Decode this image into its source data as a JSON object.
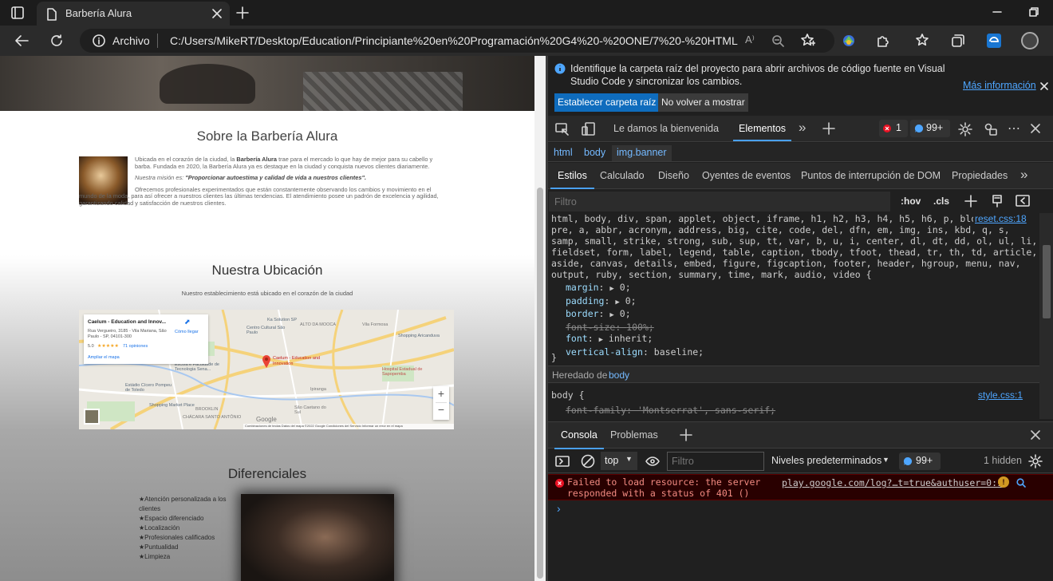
{
  "browser": {
    "tab_title": "Barbería Alura",
    "address_label": "Archivo",
    "url": "C:/Users/MikeRT/Desktop/Education/Principiante%20en%20Programación%20G4%20-%20ONE/7%20-%20HTML..."
  },
  "page": {
    "about": {
      "title": "Sobre la Barbería Alura",
      "p1_a": "Ubicada en el corazón de la ciudad, la ",
      "p1_bold": "Barbería Alura",
      "p1_b": " trae para el mercado lo que hay de mejor para su cabello y barba. Fundada en 2020, la Barbería Alura ya es destaque en la ciudad y conquista nuevos clientes diariamente.",
      "mission_label": "Nuestra misión es: ",
      "mission_quote": "\"Proporcionar autoestima y calidad de vida a nuestros clientes\".",
      "p3": "Ofrecemos profesionales experimentados que están constantemente observando los cambios y movimiento en el mundo de la moda, para así ofrecer a nuestros clientes las últimas tendencias. El atendimiento posee un padrón de excelencia y agilidad, garantizando calidad y satisfacción de nuestros clientes."
    },
    "location": {
      "title": "Nuestra Ubicación",
      "subtitle": "Nuestro establecimiento está ubicado en el corazón de la ciudad",
      "map": {
        "card_title": "Caelum - Education and Innov...",
        "card_address": "Rua Vergueiro, 3185 - Vila Mariana, São Paulo - SP, 04101-300",
        "directions": "Cómo llegar",
        "rating": "5.0",
        "stars": "★★★★★",
        "reviews": "71 opiniones",
        "enlarge": "Ampliar el mapa",
        "pin_label": "Caelum - Education and Innovation",
        "zoom_in": "+",
        "zoom_out": "−",
        "google": "Google",
        "footer": "Combinaciones de teclas   Datos del mapa ©2022 Google   Condiciones del Servicio   Informar un error en el mapa",
        "places": [
          "Ka Solution SP",
          "Centro Cultural São Paulo",
          "ALTO DA MOOCA",
          "Vila Formosa",
          "Escola e Faculdade de Tecnologia Sena...",
          "Estádio Cícero Pompeu de Toledo",
          "Ipiranga",
          "Hospital Estadual de Sapopemba",
          "Shopping Market Place",
          "BROOKLIN",
          "CHÁCARA SANTO ANTÔNIO",
          "Shopping Aricanduva",
          "São Caetano do Sul"
        ]
      }
    },
    "differentials": {
      "title": "Diferenciales",
      "items": [
        "★Atención personalizada a los clientes",
        "★Espacio diferenciado",
        "★Localización",
        "★Profesionales calificados",
        "★Puntualidad",
        "★Limpieza"
      ]
    }
  },
  "devtools": {
    "info_text": "Identifique la carpeta raíz del proyecto para abrir archivos de código fuente en Visual Studio Code y sincronizar los cambios.",
    "more_info": "Más información",
    "btn_set_root": "Establecer carpeta raíz",
    "btn_dont_show": "No volver a mostrar",
    "main_tabs": [
      "Le damos la bienvenida",
      "Elementos"
    ],
    "errors": "1",
    "issues": "99+",
    "breadcrumb": [
      "html",
      "body",
      "img.banner"
    ],
    "style_tabs": [
      "Estilos",
      "Calculado",
      "Diseño",
      "Oyentes de eventos",
      "Puntos de interrupción de DOM",
      "Propiedades"
    ],
    "filter_placeholder": "Filtro",
    "hov": ":hov",
    "cls": ".cls",
    "rule1": {
      "selector": "html, body, div, span, applet, object, iframe, h1, h2, h3, h4, h5, h6, p, blockquote, pre, a, abbr, acronym, address, big, cite, code, del, dfn, em, img, ins, kbd, q, s, samp, small, strike, strong, sub, sup, tt, var, b, u, i, center, dl, dt, dd, ol, ul, li, fieldset, form, label, legend, table, caption, tbody, tfoot, thead, tr, th, td, article, aside, canvas, details, embed, figure, figcaption, footer, header, hgroup, menu, nav, output, ruby, section, summary, time, mark, audio, video {",
      "source": "reset.css:18",
      "props": [
        {
          "name": "margin",
          "value": "0;",
          "arrow": true,
          "strike": false
        },
        {
          "name": "padding",
          "value": "0;",
          "arrow": true,
          "strike": false
        },
        {
          "name": "border",
          "value": "0;",
          "arrow": true,
          "strike": false
        },
        {
          "name": "font-size",
          "value": "100%;",
          "arrow": false,
          "strike": true
        },
        {
          "name": "font",
          "value": "inherit;",
          "arrow": true,
          "strike": false
        },
        {
          "name": "vertical-align",
          "value": "baseline;",
          "arrow": false,
          "strike": false
        }
      ]
    },
    "inherited_label": "Heredado de",
    "inherited_from": "body",
    "rule2": {
      "selector": "body {",
      "source": "style.css:1",
      "prop": "font-family: 'Montserrat', sans-serif;"
    },
    "drawer_tabs": [
      "Consola",
      "Problemas"
    ],
    "console_context": "top",
    "console_filter": "Filtro",
    "levels": "Niveles predeterminados",
    "console_issues": "99+",
    "hidden": "1 hidden",
    "error_msg": "Failed to load resource: the server responded with a status of 401 ()",
    "error_src": "play.google.com/log?…t=true&authuser=0:1",
    "prompt": "›"
  }
}
